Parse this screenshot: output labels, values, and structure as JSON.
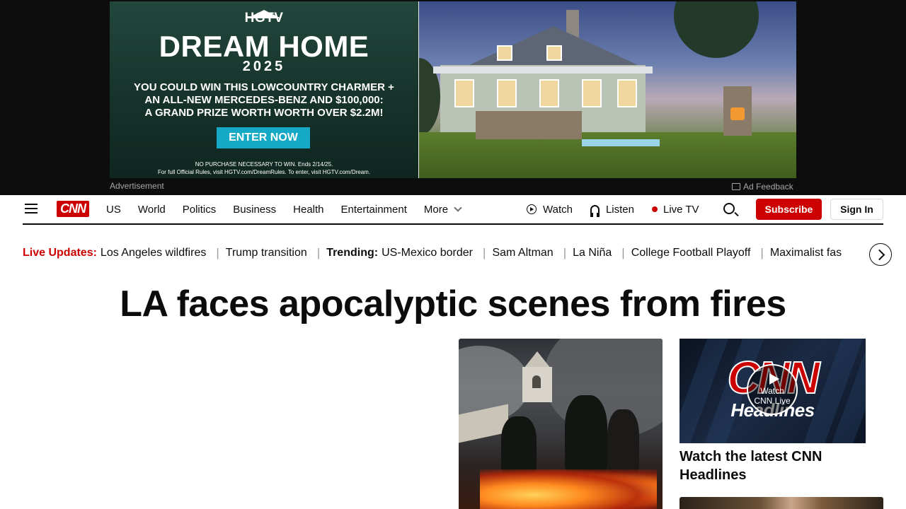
{
  "ad": {
    "brand": "HGTV",
    "title": "DREAM HOME",
    "year": "2025",
    "copy_line1": "YOU COULD WIN THIS LOWCOUNTRY CHARMER +",
    "copy_line2": "AN ALL-NEW MERCEDES-BENZ AND $100,000:",
    "copy_line3": "A GRAND PRIZE WORTH WORTH OVER $2.2M!",
    "cta": "ENTER NOW",
    "fine1": "NO PURCHASE NECESSARY TO WIN. Ends 2/14/25.",
    "fine2": "For full Official Rules, visit HGTV.com/DreamRules. To enter, visit HGTV.com/Dream.",
    "label": "Advertisement",
    "feedback": "Ad Feedback",
    "accent": "#15a9c5"
  },
  "header": {
    "logo": "CNN",
    "nav": [
      "US",
      "World",
      "Politics",
      "Business",
      "Health",
      "Entertainment"
    ],
    "more": "More",
    "watch": "Watch",
    "listen": "Listen",
    "live_tv": "Live TV",
    "subscribe": "Subscribe",
    "sign_in": "Sign In",
    "brand_color": "#cc0000"
  },
  "ticker": {
    "live_label": "Live Updates:",
    "live_items": [
      "Los Angeles wildfires",
      "Trump transition"
    ],
    "trending_label": "Trending:",
    "trending_items": [
      "US-Mexico border",
      "Sam Altman",
      "La Niña",
      "College Football Playoff",
      "Maximalist fas"
    ]
  },
  "main": {
    "headline": "LA faces apocalyptic scenes from fires",
    "video": {
      "logo": "CNN",
      "brand": "Headlines",
      "play_line1": "Watch",
      "play_line2": "CNN Live",
      "caption": "Watch the latest CNN Headlines"
    }
  }
}
